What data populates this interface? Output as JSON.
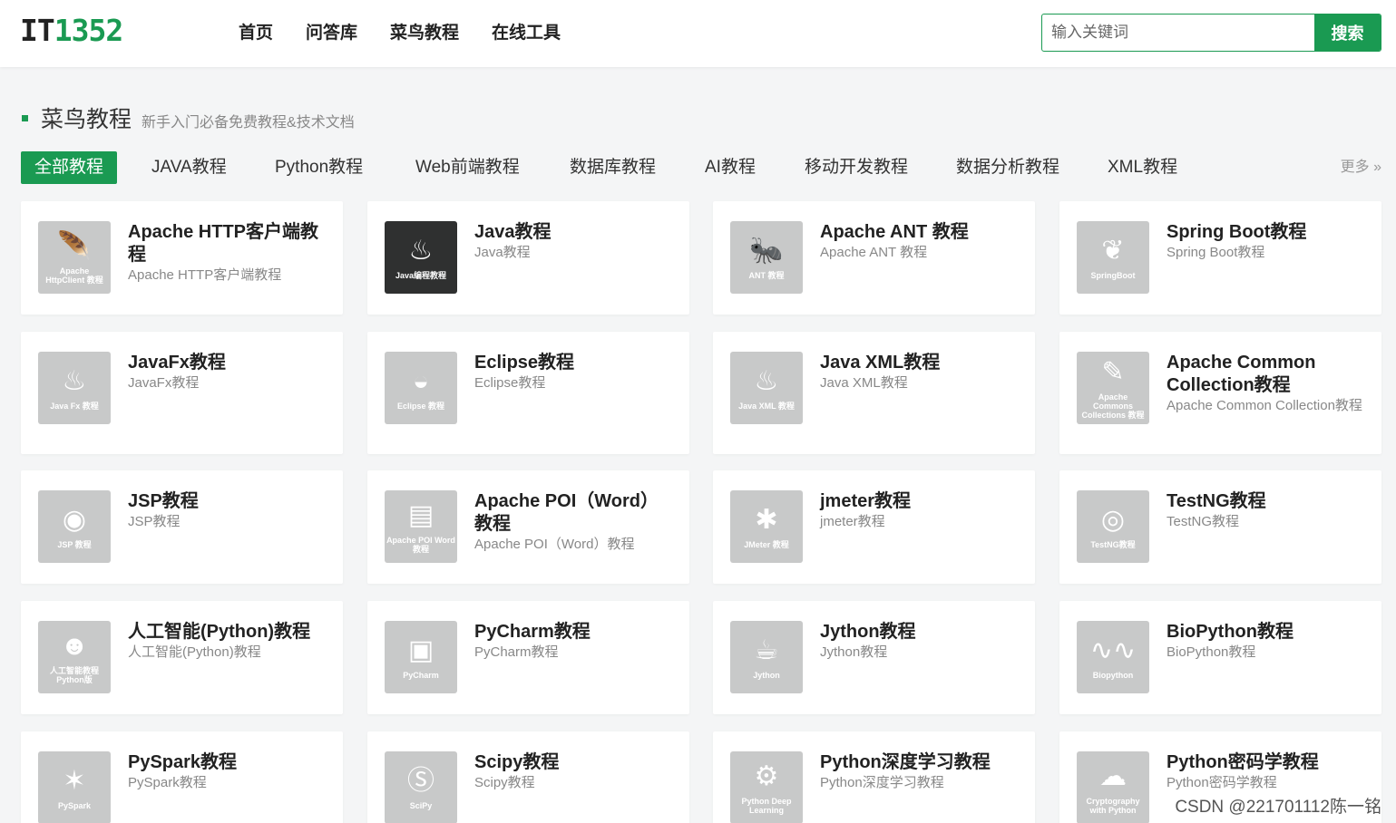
{
  "header": {
    "logo_part1": "IT",
    "logo_part2": "1352",
    "nav": [
      "首页",
      "问答库",
      "菜鸟教程",
      "在线工具"
    ],
    "search_placeholder": "输入关键词",
    "search_button": "搜索"
  },
  "section": {
    "title": "菜鸟教程",
    "subtitle": "新手入门必备免费教程&技术文档"
  },
  "tabs": [
    "全部教程",
    "JAVA教程",
    "Python教程",
    "Web前端教程",
    "数据库教程",
    "AI教程",
    "移动开发教程",
    "数据分析教程",
    "XML教程"
  ],
  "more": "更多 »",
  "cards": [
    {
      "title": "Apache HTTP客户端教程",
      "desc": "Apache HTTP客户端教程",
      "icon": "feather-icon",
      "glyph": "🪶",
      "caption": "Apache HttpClient 教程"
    },
    {
      "title": "Java教程",
      "desc": "Java教程",
      "icon": "java-cup-icon",
      "glyph": "♨",
      "caption": "Java编程教程",
      "dark": true
    },
    {
      "title": "Apache ANT 教程",
      "desc": "Apache ANT 教程",
      "icon": "ant-icon",
      "glyph": "🐜",
      "caption": "ANT 教程"
    },
    {
      "title": "Spring Boot教程",
      "desc": "Spring Boot教程",
      "icon": "spring-leaf-icon",
      "glyph": "❦",
      "caption": "SpringBoot"
    },
    {
      "title": "JavaFx教程",
      "desc": "JavaFx教程",
      "icon": "java-cup-icon",
      "glyph": "♨",
      "caption": "Java Fx 教程"
    },
    {
      "title": "Eclipse教程",
      "desc": "Eclipse教程",
      "icon": "eclipse-icon",
      "glyph": "◒",
      "caption": "Eclipse 教程"
    },
    {
      "title": "Java XML教程",
      "desc": "Java XML教程",
      "icon": "java-cup-icon",
      "glyph": "♨",
      "caption": "Java XML 教程"
    },
    {
      "title": "Apache Common Collection教程",
      "desc": "Apache Common Collection教程",
      "icon": "apache-feather-icon",
      "glyph": "✎",
      "caption": "Apache Commons Collections 教程"
    },
    {
      "title": "JSP教程",
      "desc": "JSP教程",
      "icon": "camera-icon",
      "glyph": "◉",
      "caption": "JSP 教程"
    },
    {
      "title": "Apache POI（Word）教程",
      "desc": "Apache POI（Word）教程",
      "icon": "document-icon",
      "glyph": "▤",
      "caption": "Apache POI Word 教程"
    },
    {
      "title": "jmeter教程",
      "desc": "jmeter教程",
      "icon": "tools-icon",
      "glyph": "✱",
      "caption": "JMeter 教程"
    },
    {
      "title": "TestNG教程",
      "desc": "TestNG教程",
      "icon": "eye-icon",
      "glyph": "◎",
      "caption": "TestNG教程"
    },
    {
      "title": "人工智能(Python)教程",
      "desc": "人工智能(Python)教程",
      "icon": "ai-head-icon",
      "glyph": "☻",
      "caption": "人工智能教程 Python版"
    },
    {
      "title": "PyCharm教程",
      "desc": "PyCharm教程",
      "icon": "pycharm-icon",
      "glyph": "▣",
      "caption": "PyCharm"
    },
    {
      "title": "Jython教程",
      "desc": "Jython教程",
      "icon": "jython-cup-icon",
      "glyph": "☕",
      "caption": "Jython"
    },
    {
      "title": "BioPython教程",
      "desc": "BioPython教程",
      "icon": "dna-icon",
      "glyph": "∿∿",
      "caption": "Biopython"
    },
    {
      "title": "PySpark教程",
      "desc": "PySpark教程",
      "icon": "spark-icon",
      "glyph": "✶",
      "caption": "PySpark"
    },
    {
      "title": "Scipy教程",
      "desc": "Scipy教程",
      "icon": "scipy-icon",
      "glyph": "Ⓢ",
      "caption": "SciPy"
    },
    {
      "title": "Python深度学习教程",
      "desc": "Python深度学习教程",
      "icon": "gear-magnifier-icon",
      "glyph": "⚙",
      "caption": "Python Deep Learning"
    },
    {
      "title": "Python密码学教程",
      "desc": "Python密码学教程",
      "icon": "cloud-icon",
      "glyph": "☁",
      "caption": "Cryptography with Python"
    }
  ],
  "watermark": "CSDN @221701112陈一铭"
}
